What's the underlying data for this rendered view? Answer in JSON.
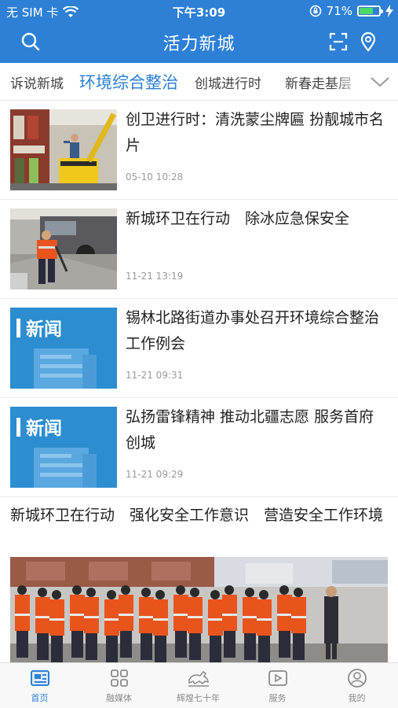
{
  "status_bar": {
    "carrier": "无 SIM 卡",
    "time": "下午3:09",
    "battery_text": "71%",
    "battery_level": 0.71
  },
  "header": {
    "title": "活力新城"
  },
  "tabs": [
    {
      "label": "诉说新城",
      "active": false
    },
    {
      "label": "环境综合整治",
      "active": true
    },
    {
      "label": "创城进行时",
      "active": false
    },
    {
      "label": "新春走基层",
      "active": false
    }
  ],
  "news": [
    {
      "title": "创卫进行时：清洗蒙尘牌匾 扮靓城市名片",
      "time": "05-10 10:28",
      "thumb": "photo-cleaning-signboard"
    },
    {
      "title": "新城环卫在行动　除冰应急保安全",
      "time": "11-21 13:19",
      "thumb": "photo-deicing-worker"
    },
    {
      "title": "锡林北路街道办事处召开环境综合整治工作例会",
      "time": "11-21 09:31",
      "thumb": "news-placeholder",
      "thumb_label": "新闻"
    },
    {
      "title": "弘扬雷锋精神 推动北疆志愿 服务首府创城",
      "time": "11-21 09:29",
      "thumb": "news-placeholder",
      "thumb_label": "新闻"
    }
  ],
  "feature": {
    "title": "新城环卫在行动　强化安全工作意识　营造安全工作环境"
  },
  "tabbar": [
    {
      "label": "首页",
      "icon": "home-icon",
      "active": true
    },
    {
      "label": "融媒体",
      "icon": "grid-icon",
      "active": false
    },
    {
      "label": "辉煌七十年",
      "icon": "horse-icon",
      "active": false
    },
    {
      "label": "服务",
      "icon": "play-icon",
      "active": false
    },
    {
      "label": "我的",
      "icon": "user-icon",
      "active": false
    }
  ],
  "colors": {
    "brand": "#2d80d6",
    "tab_active": "#2d80d6",
    "news_placeholder": "#2c8dd0",
    "vest_orange": "#e8541c"
  }
}
